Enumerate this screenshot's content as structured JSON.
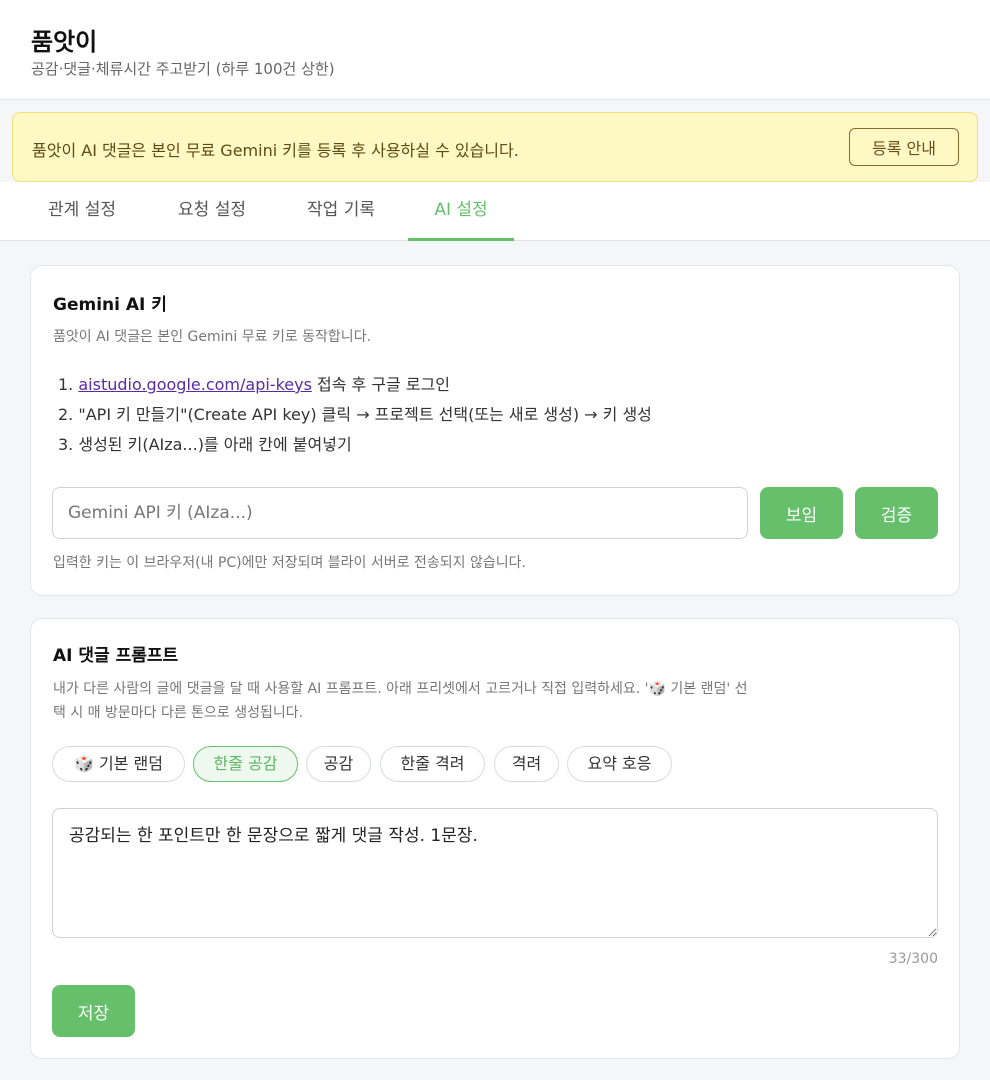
{
  "header": {
    "title": "품앗이",
    "subtitle": "공감·댓글·체류시간 주고받기 (하루 100건 상한)"
  },
  "notice": {
    "text": "품앗이 AI 댓글은 본인 무료 Gemini 키를 등록 후 사용하실 수 있습니다.",
    "button_label": "등록 안내"
  },
  "tabs": [
    {
      "label": "관계 설정",
      "active": false
    },
    {
      "label": "요청 설정",
      "active": false
    },
    {
      "label": "작업 기록",
      "active": false
    },
    {
      "label": "AI 설정",
      "active": true
    }
  ],
  "gemini_card": {
    "title": "Gemini AI 키",
    "description": "품앗이 AI 댓글은 본인 Gemini 무료 키로 동작합니다.",
    "steps": [
      {
        "num": "1.",
        "link": "aistudio.google.com/api-keys",
        "text": " 접속 후 구글 로그인"
      },
      {
        "num": "2.",
        "text": "\"API 키 만들기\"(Create API key) 클릭 → 프로젝트 선택(또는 새로 생성) → 키 생성"
      },
      {
        "num": "3.",
        "text": "생성된 키(AIza...)를 아래 칸에 붙여넣기"
      }
    ],
    "input_placeholder": "Gemini API 키 (AIza...)",
    "input_value": "",
    "show_button": "보임",
    "verify_button": "검증",
    "note": "입력한 키는 이 브라우저(내 PC)에만 저장되며 블라이 서버로 전송되지 않습니다."
  },
  "prompt_card": {
    "title": "AI 댓글 프롬프트",
    "description_line1": "내가 다른 사람의 글에 댓글을 달 때 사용할 AI 프롬프트. 아래 프리셋에서 고르거나 직접 입력하세요. '🎲 기본 랜덤' 선",
    "description_line2": "택 시 매 방문마다 다른 톤으로 생성됩니다.",
    "presets": [
      {
        "icon": "dice-icon",
        "label": "기본 랜덤",
        "active": false
      },
      {
        "label": "한줄 공감",
        "active": true
      },
      {
        "label": "공감",
        "active": false
      },
      {
        "label": "한줄 격려",
        "active": false
      },
      {
        "label": "격려",
        "active": false
      },
      {
        "label": "요약 호응",
        "active": false
      }
    ],
    "prompt_value": "공감되는 한 포인트만 한 문장으로 짧게 댓글 작성. 1문장.",
    "char_count": "33/300",
    "save_button": "저장"
  },
  "colors": {
    "accent_green": "#66c06b",
    "notice_bg": "#fef8c5",
    "link_purple": "#5b2aa3"
  }
}
